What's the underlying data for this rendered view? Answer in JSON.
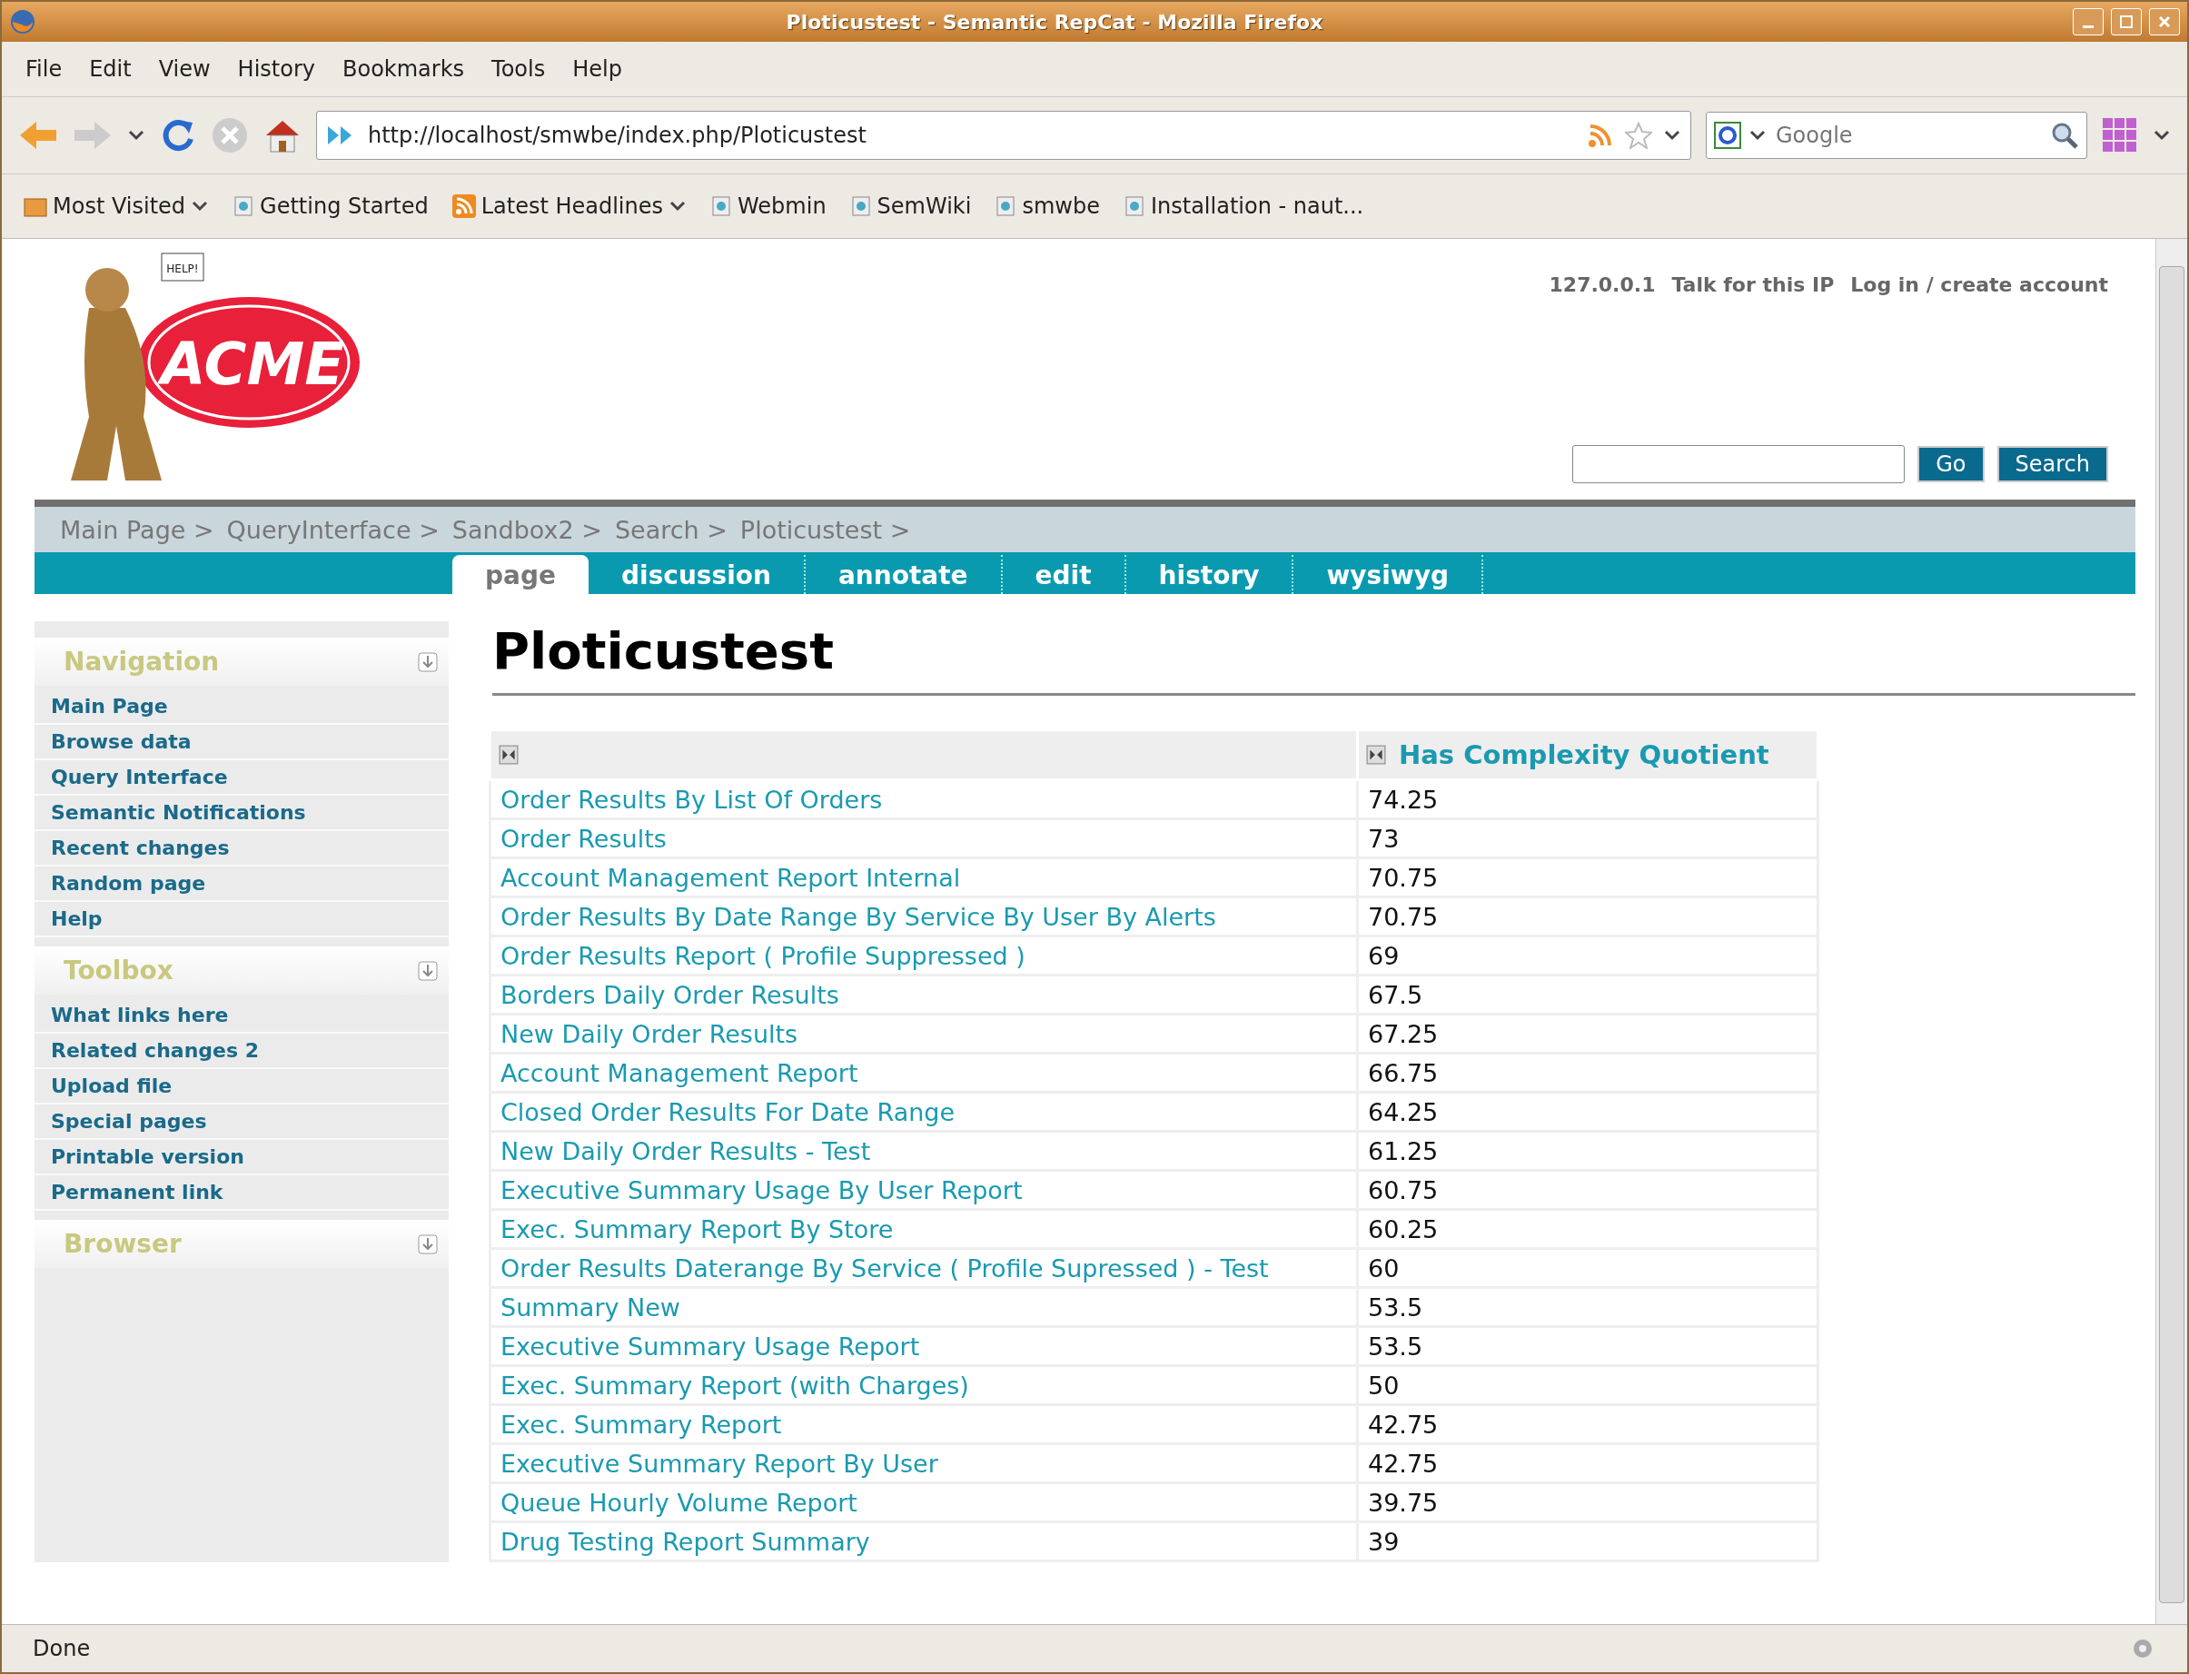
{
  "window": {
    "title": "Ploticustest - Semantic RepCat - Mozilla Firefox"
  },
  "menu": [
    "File",
    "Edit",
    "View",
    "History",
    "Bookmarks",
    "Tools",
    "Help"
  ],
  "navigation_bar": {
    "url": "http://localhost/smwbe/index.php/Ploticustest",
    "search_placeholder": "Google"
  },
  "bookmarks": [
    {
      "label": "Most Visited",
      "kind": "folder"
    },
    {
      "label": "Getting Started",
      "kind": "page"
    },
    {
      "label": "Latest Headlines",
      "kind": "feed"
    },
    {
      "label": "Webmin",
      "kind": "page"
    },
    {
      "label": "SemWiki",
      "kind": "page"
    },
    {
      "label": "smwbe",
      "kind": "page"
    },
    {
      "label": "Installation - naut...",
      "kind": "page"
    }
  ],
  "logo": {
    "text": "ACME",
    "sign": "HELP!"
  },
  "personal_links": [
    "127.0.0.1",
    "Talk for this IP",
    "Log in / create account"
  ],
  "site_search": {
    "buttons": [
      "Go",
      "Search"
    ]
  },
  "breadcrumbs": [
    "Main Page >",
    "QueryInterface >",
    "Sandbox2 >",
    "Search >",
    "Ploticustest >"
  ],
  "tabs": [
    {
      "label": "page",
      "selected": true
    },
    {
      "label": "discussion",
      "selected": false
    },
    {
      "label": "annotate",
      "selected": false
    },
    {
      "label": "edit",
      "selected": false
    },
    {
      "label": "history",
      "selected": false
    },
    {
      "label": "wysiwyg",
      "selected": false
    }
  ],
  "sidebar": [
    {
      "title": "Navigation",
      "items": [
        "Main Page",
        "Browse data",
        "Query Interface",
        "Semantic Notifications",
        "Recent changes",
        "Random page",
        "Help"
      ]
    },
    {
      "title": "Toolbox",
      "items": [
        "What links here",
        "Related changes 2",
        "Upload file",
        "Special pages",
        "Printable version",
        "Permanent link"
      ]
    },
    {
      "title": "Browser"
    }
  ],
  "page_title": "Ploticustest",
  "table": {
    "columns": [
      "",
      "Has Complexity Quotient"
    ],
    "rows": [
      [
        "Order Results By List Of Orders",
        "74.25"
      ],
      [
        "Order Results",
        "73"
      ],
      [
        "Account Management Report Internal",
        "70.75"
      ],
      [
        "Order Results By Date Range By Service By User By Alerts",
        "70.75"
      ],
      [
        "Order Results Report ( Profile Suppressed )",
        "69"
      ],
      [
        "Borders Daily Order Results",
        "67.5"
      ],
      [
        "New Daily Order Results",
        "67.25"
      ],
      [
        "Account Management Report",
        "66.75"
      ],
      [
        "Closed Order Results For Date Range",
        "64.25"
      ],
      [
        "New Daily Order Results - Test",
        "61.25"
      ],
      [
        "Executive Summary Usage By User Report",
        "60.75"
      ],
      [
        "Exec. Summary Report By Store",
        "60.25"
      ],
      [
        "Order Results Daterange By Service ( Profile Supressed ) - Test",
        "60"
      ],
      [
        "Summary New",
        "53.5"
      ],
      [
        "Executive Summary Usage Report",
        "53.5"
      ],
      [
        "Exec. Summary Report (with Charges)",
        "50"
      ],
      [
        "Exec. Summary Report",
        "42.75"
      ],
      [
        "Executive Summary Report By User",
        "42.75"
      ],
      [
        "Queue Hourly Volume Report",
        "39.75"
      ],
      [
        "Drug Testing Report Summary",
        "39"
      ]
    ]
  },
  "status_bar": "Done"
}
